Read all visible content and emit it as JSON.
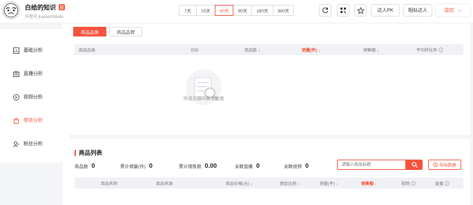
{
  "account": {
    "name": "白给的知识",
    "badge": "日",
    "id_text": "抖音号 jiuyaochiduilu"
  },
  "periods": [
    "7天",
    "15天",
    "30天",
    "90天",
    "180天",
    "360天"
  ],
  "active_period": "30天",
  "header_buttons": {
    "pk": "达人PK",
    "similar": "相似达人",
    "monitor": "监控"
  },
  "sidebar": {
    "items": [
      {
        "label": "基础分析",
        "icon": "basic-analysis-icon"
      },
      {
        "label": "直播分析",
        "icon": "live-analysis-icon"
      },
      {
        "label": "视频分析",
        "icon": "video-analysis-icon"
      },
      {
        "label": "带货分析",
        "icon": "sales-analysis-icon",
        "active": true
      },
      {
        "label": "粉丝分析",
        "icon": "fans-analysis-icon"
      }
    ]
  },
  "category_section": {
    "tabs": [
      "商品品类",
      "商品品牌"
    ],
    "columns": [
      "商品品类",
      "均价",
      "商品数 ↓",
      "销量(件) ↓",
      "销售额 ↓",
      "平均转化率"
    ],
    "empty_text": "所选日期内暂无数据"
  },
  "product_section": {
    "title": "商品列表",
    "stats": [
      {
        "label": "商品数",
        "value": "0"
      },
      {
        "label": "累计销量(件)",
        "value": "0"
      },
      {
        "label": "累计销售额",
        "value": "0.00"
      },
      {
        "label": "关联直播",
        "value": "0"
      },
      {
        "label": "关联视频",
        "value": "0"
      }
    ],
    "search_placeholder": "请输入商品标题",
    "export_label": "导出数据",
    "columns": [
      "商品名称",
      "商品来源",
      "商品价格(元) ↓",
      "佣金比例 ↓",
      "销量(件) ↓",
      "销售额 ↓",
      "视频",
      "直播"
    ]
  },
  "colors": {
    "accent": "#f5533d"
  }
}
